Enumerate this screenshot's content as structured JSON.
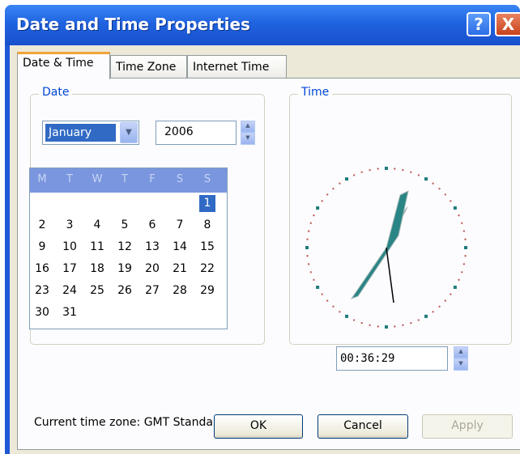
{
  "window": {
    "title": "Date and Time Properties",
    "help_label": "?",
    "close_label": "X"
  },
  "tabs": [
    {
      "label": "Date & Time",
      "active": true
    },
    {
      "label": "Time Zone",
      "active": false
    },
    {
      "label": "Internet Time",
      "active": false
    }
  ],
  "date_group": {
    "label": "Date",
    "month": "January",
    "year": "2006",
    "weekday_headers": [
      "M",
      "T",
      "W",
      "T",
      "F",
      "S",
      "S"
    ],
    "weeks": [
      [
        "",
        "",
        "",
        "",
        "",
        "",
        "1"
      ],
      [
        "2",
        "3",
        "4",
        "5",
        "6",
        "7",
        "8"
      ],
      [
        "9",
        "10",
        "11",
        "12",
        "13",
        "14",
        "15"
      ],
      [
        "16",
        "17",
        "18",
        "19",
        "20",
        "21",
        "22"
      ],
      [
        "23",
        "24",
        "25",
        "26",
        "27",
        "28",
        "29"
      ],
      [
        "30",
        "31",
        "",
        "",
        "",
        "",
        ""
      ]
    ],
    "selected_day": "1"
  },
  "time_group": {
    "label": "Time",
    "time": "00:36:29"
  },
  "timezone": {
    "label": "Current time zone:",
    "value": "GMT Standard Time"
  },
  "buttons": {
    "ok": "OK",
    "cancel": "Cancel",
    "apply": "Apply"
  },
  "colors": {
    "titlebar": "#1f63e0",
    "selection": "#316ac5",
    "calendar_header": "#7a96df",
    "group_label": "#0046d5"
  },
  "icons": {
    "help": "help-icon",
    "close": "close-icon",
    "dropdown": "chevron-down-icon",
    "spin": "spin-arrows-icon"
  }
}
